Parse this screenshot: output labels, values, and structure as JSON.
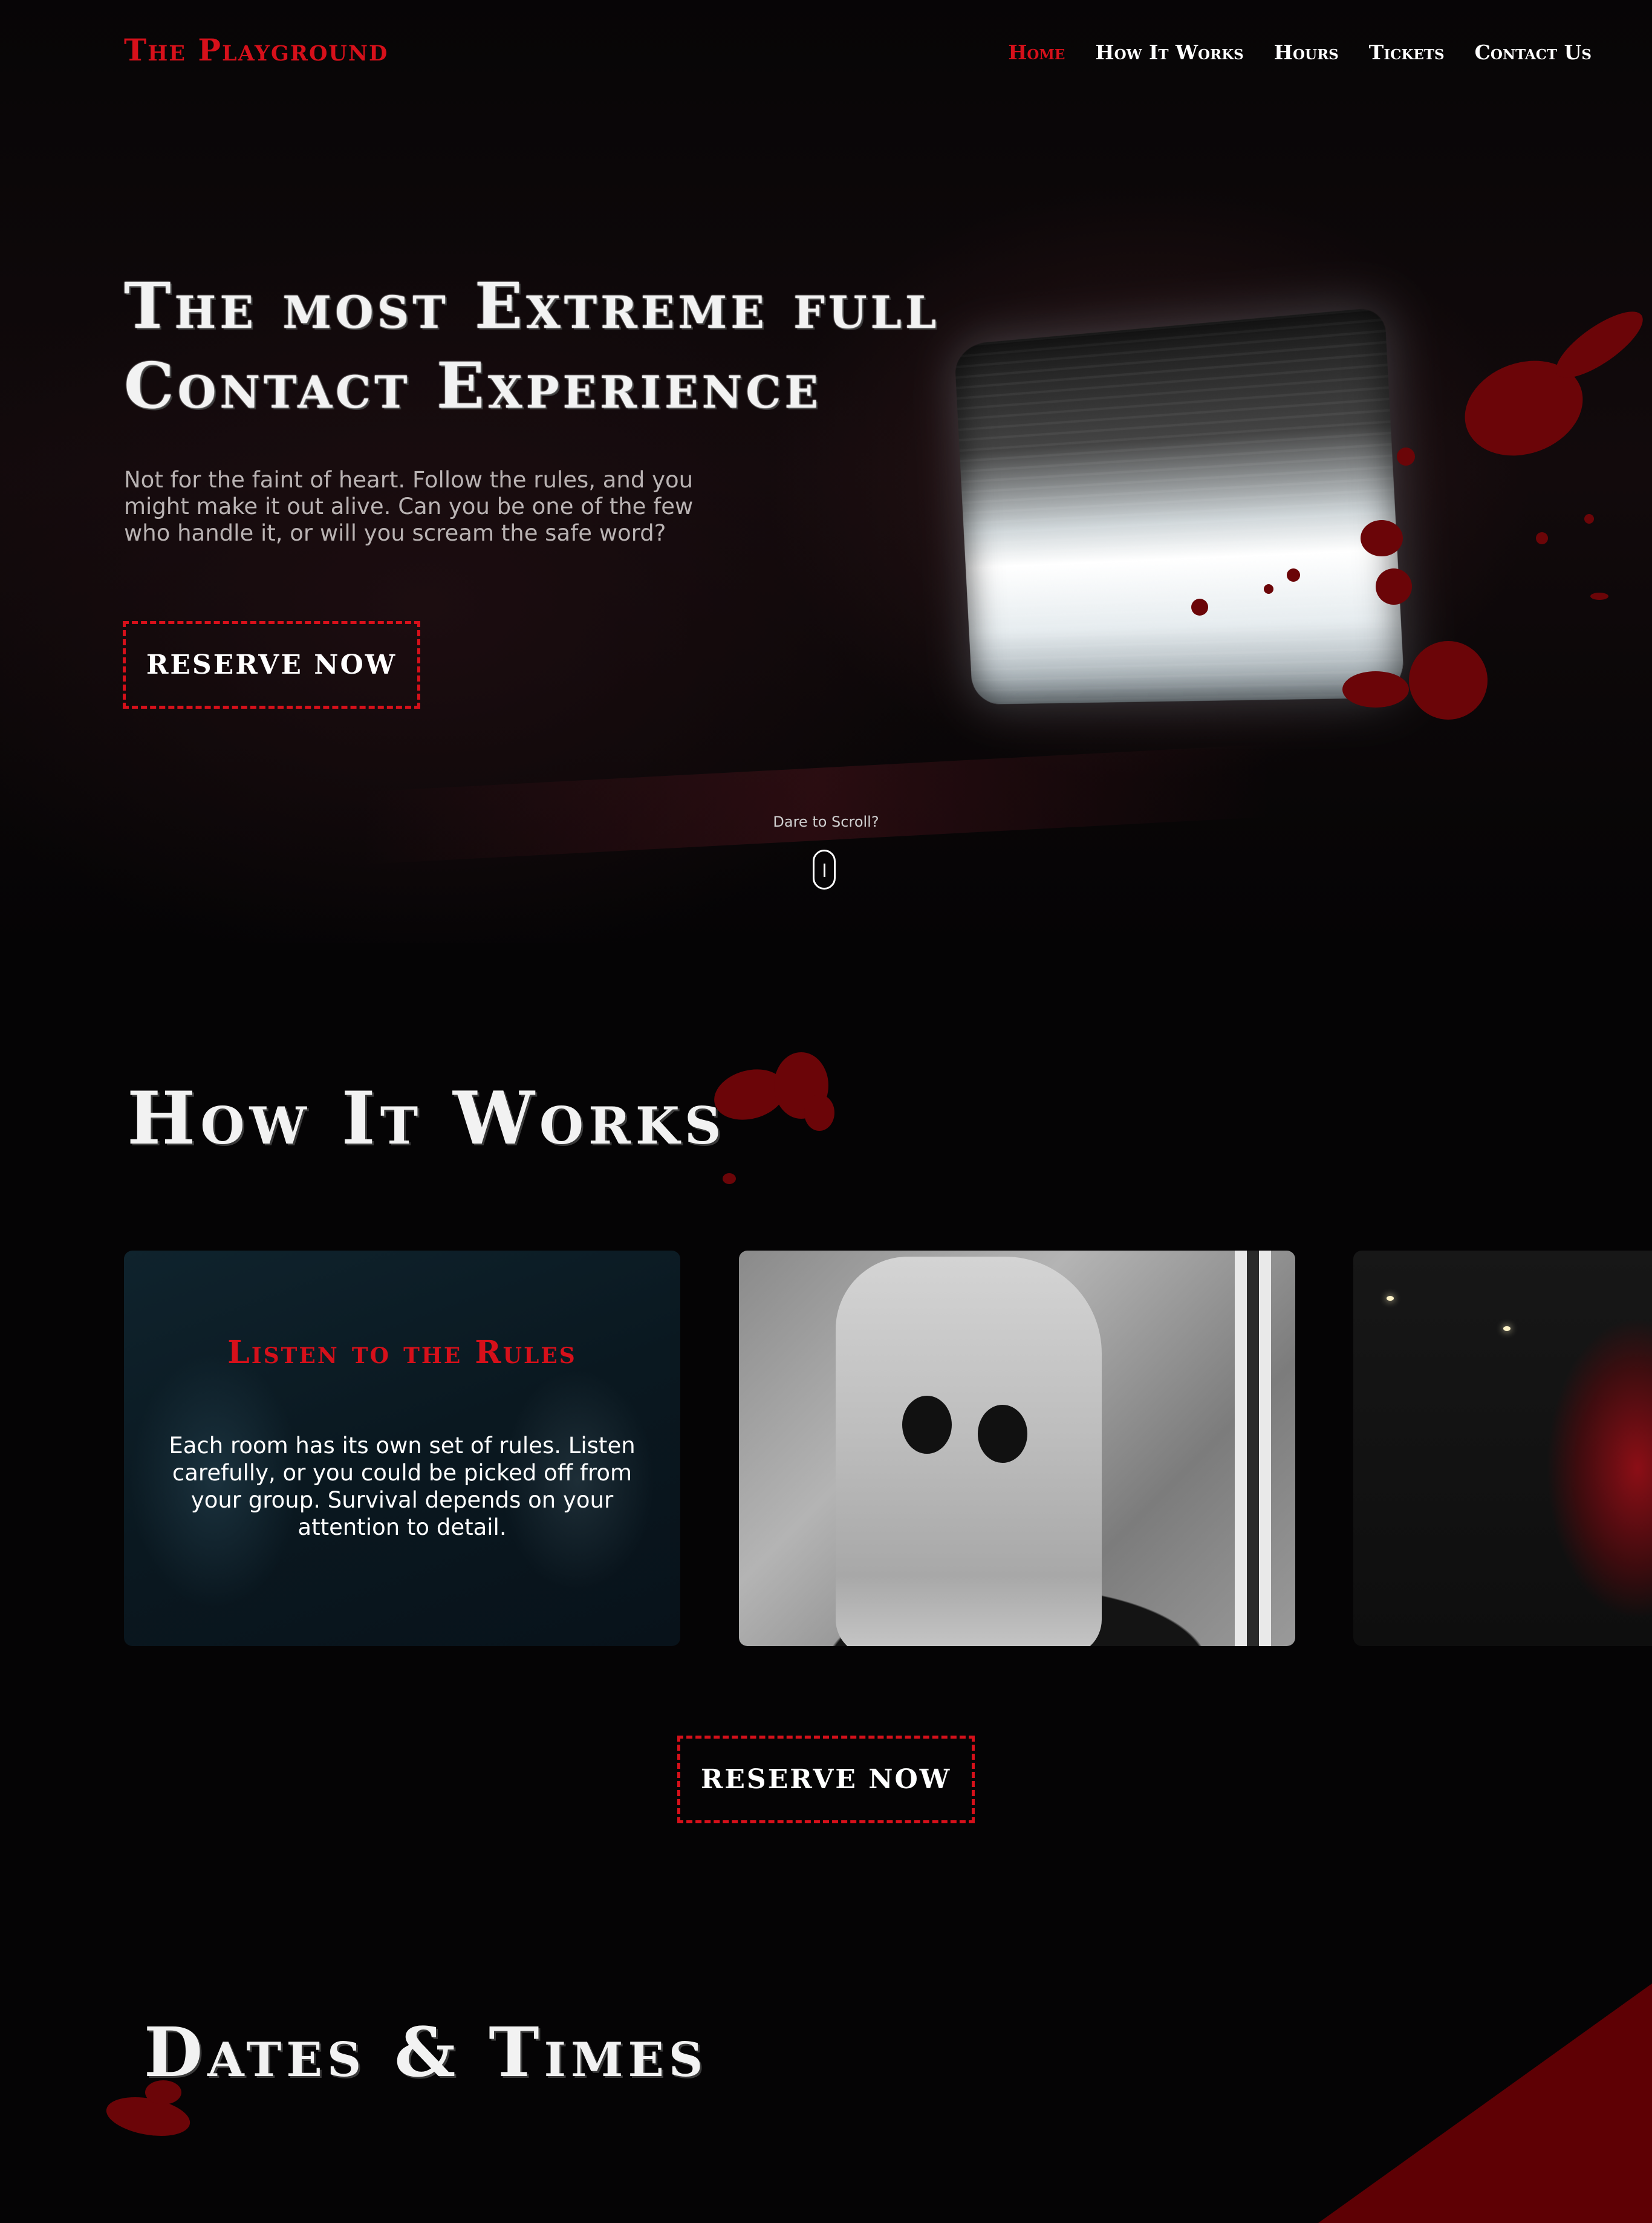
{
  "header": {
    "logo": "The Playground",
    "nav": [
      {
        "label": "Home",
        "active": true
      },
      {
        "label": "How It Works",
        "active": false
      },
      {
        "label": "Hours",
        "active": false
      },
      {
        "label": "Tickets",
        "active": false
      },
      {
        "label": "Contact Us",
        "active": false
      }
    ]
  },
  "hero": {
    "title_line1": "The most Extreme full",
    "title_line2": "Contact Experience",
    "text": "Not for the faint of heart. Follow the rules, and you might make it out alive. Can you be one of the few who handle it, or will you scream the safe word?",
    "button_label": "RESERVE NOW",
    "scroll_label": "Dare to Scroll?"
  },
  "how_it_works": {
    "title": "How It Works",
    "cards": [
      {
        "title": "Listen to the Rules",
        "text": "Each room has its own set of rules. Listen carefully, or you could be picked off from your group. Survival depends on your attention to detail."
      }
    ],
    "button_label": "RESERVE NOW"
  },
  "dates": {
    "title": "Dates & Times"
  },
  "colors": {
    "accent": "#d6101a",
    "background": "#050405",
    "blood": "#6b0508"
  },
  "icons": {
    "scroll": "mouse-scroll-icon"
  }
}
